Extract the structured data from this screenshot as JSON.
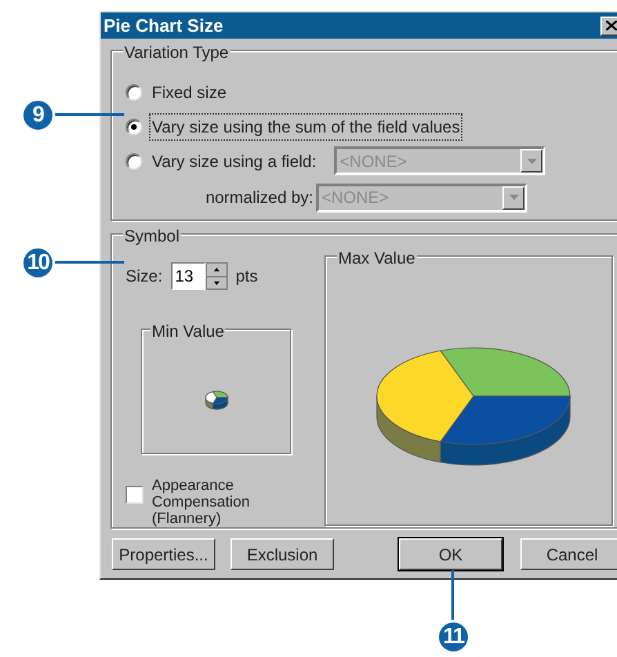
{
  "window": {
    "title": "Pie Chart Size"
  },
  "variation_type": {
    "label": "Variation Type",
    "options": [
      {
        "label": "Fixed size",
        "selected": false
      },
      {
        "label": "Vary size using the sum of the field values",
        "selected": true
      },
      {
        "label": "Vary size using a field:",
        "selected": false
      }
    ],
    "field_dropdown": {
      "value": "<NONE>",
      "disabled": true
    },
    "normalized_by": {
      "label": "normalized by:",
      "value": "<NONE>",
      "disabled": true
    }
  },
  "symbol": {
    "label": "Symbol",
    "size_label": "Size:",
    "size": "13",
    "unit": "pts",
    "min_value_label": "Min Value",
    "max_value_label": "Max Value",
    "appearance_compensation": {
      "label": "Appearance Compensation (Flannery)",
      "checked": false
    }
  },
  "buttons": [
    {
      "label": "Properties...",
      "default": false
    },
    {
      "label": "Exclusion",
      "default": false
    },
    {
      "label": "OK",
      "default": true
    },
    {
      "label": "Cancel",
      "default": false
    }
  ],
  "callouts": [
    {
      "number": "9"
    },
    {
      "number": "10"
    },
    {
      "number": "11"
    }
  ]
}
